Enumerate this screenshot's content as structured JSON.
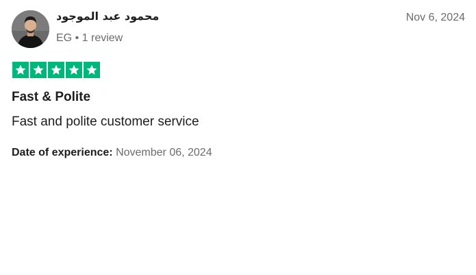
{
  "reviewer": {
    "name": "محمود عبد الموجود",
    "country": "EG",
    "separator": "•",
    "review_count": "1 review"
  },
  "review": {
    "date": "Nov 6, 2024",
    "rating": 5,
    "star_color": "#00b67a",
    "title": "Fast & Polite",
    "body": "Fast and polite customer service",
    "experience_label": "Date of experience:",
    "experience_date": "November 06, 2024"
  }
}
